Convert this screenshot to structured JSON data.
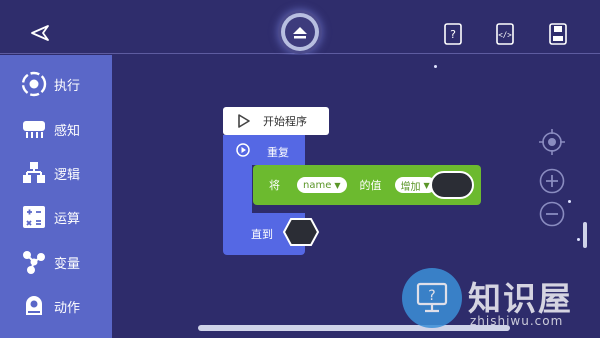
{
  "toolbar": {
    "back_icon": "back-arrow-icon",
    "collapse_icon": "chevron-up-icon",
    "help_icon": "help-book-icon",
    "code_icon": "code-file-icon",
    "save_icon": "save-icon"
  },
  "sidebar": {
    "items": [
      {
        "label": "执行",
        "icon": "execute-icon"
      },
      {
        "label": "感知",
        "icon": "sense-icon"
      },
      {
        "label": "逻辑",
        "icon": "logic-icon"
      },
      {
        "label": "运算",
        "icon": "operator-icon"
      },
      {
        "label": "变量",
        "icon": "variable-icon"
      },
      {
        "label": "动作",
        "icon": "action-icon"
      }
    ]
  },
  "blocks": {
    "start": {
      "label": "开始程序"
    },
    "repeat": {
      "label": "重复"
    },
    "set": {
      "prefix": "将",
      "variable": "name",
      "middle": "的值",
      "operation": "增加"
    },
    "until": {
      "label": "直到"
    }
  },
  "watermark": {
    "title": "知识屋",
    "url": "zhishiwu.com"
  },
  "colors": {
    "background": "#2e2c6b",
    "sidebar": "#5a67c8",
    "control_block": "#5568e4",
    "variable_block": "#6cba2f"
  }
}
